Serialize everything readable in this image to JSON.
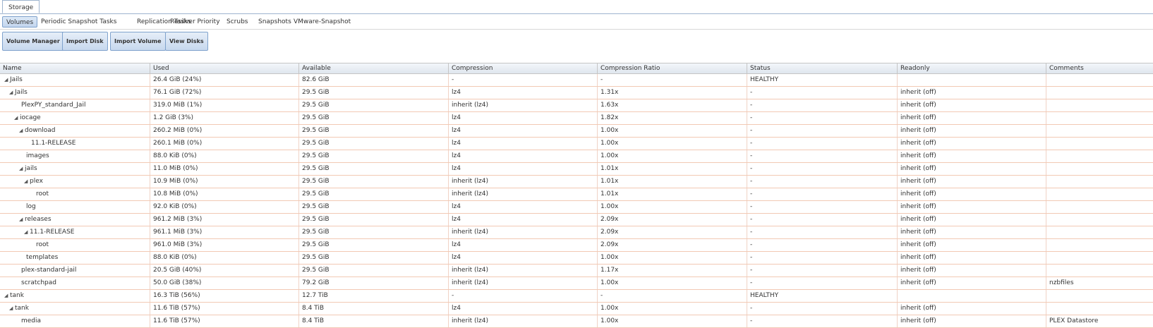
{
  "top_tab": "Storage",
  "subtabs": [
    "Volumes",
    "Periodic Snapshot Tasks",
    "Replication Tasks",
    "Resilver Priority",
    "Scrubs",
    "Snapshots",
    "VMware-Snapshot"
  ],
  "buttons": [
    "Volume Manager",
    "Import Disk",
    "Import Volume",
    "View Disks"
  ],
  "columns": [
    "Name",
    "Used",
    "Available",
    "Compression",
    "Compression Ratio",
    "Status",
    "Readonly",
    "Comments"
  ],
  "rows": [
    {
      "name": "Jails",
      "expanded": true,
      "used": "26.4 GiB (24%)",
      "available": "82.6 GiB",
      "compression": "-",
      "ratio": "-",
      "status": "HEALTHY",
      "readonly": "",
      "comments": ""
    },
    {
      "name": "Jails",
      "expanded": true,
      "used": "76.1 GiB (72%)",
      "available": "29.5 GiB",
      "compression": "lz4",
      "ratio": "1.31x",
      "status": "-",
      "readonly": "inherit (off)",
      "comments": ""
    },
    {
      "name": "PlexPY_standard_Jail",
      "expanded": false,
      "used": "319.0 MiB (1%)",
      "available": "29.5 GiB",
      "compression": "inherit (lz4)",
      "ratio": "1.63x",
      "status": "-",
      "readonly": "inherit (off)",
      "comments": ""
    },
    {
      "name": "iocage",
      "expanded": true,
      "used": "1.2 GiB (3%)",
      "available": "29.5 GiB",
      "compression": "lz4",
      "ratio": "1.82x",
      "status": "-",
      "readonly": "inherit (off)",
      "comments": ""
    },
    {
      "name": "download",
      "expanded": true,
      "used": "260.2 MiB (0%)",
      "available": "29.5 GiB",
      "compression": "lz4",
      "ratio": "1.00x",
      "status": "-",
      "readonly": "inherit (off)",
      "comments": ""
    },
    {
      "name": "11.1-RELEASE",
      "expanded": false,
      "used": "260.1 MiB (0%)",
      "available": "29.5 GiB",
      "compression": "lz4",
      "ratio": "1.00x",
      "status": "-",
      "readonly": "inherit (off)",
      "comments": ""
    },
    {
      "name": "images",
      "expanded": false,
      "used": "88.0 KiB (0%)",
      "available": "29.5 GiB",
      "compression": "lz4",
      "ratio": "1.00x",
      "status": "-",
      "readonly": "inherit (off)",
      "comments": ""
    },
    {
      "name": "jails",
      "expanded": true,
      "used": "11.0 MiB (0%)",
      "available": "29.5 GiB",
      "compression": "lz4",
      "ratio": "1.01x",
      "status": "-",
      "readonly": "inherit (off)",
      "comments": ""
    },
    {
      "name": "plex",
      "expanded": true,
      "used": "10.9 MiB (0%)",
      "available": "29.5 GiB",
      "compression": "inherit (lz4)",
      "ratio": "1.01x",
      "status": "-",
      "readonly": "inherit (off)",
      "comments": ""
    },
    {
      "name": "root",
      "expanded": false,
      "used": "10.8 MiB (0%)",
      "available": "29.5 GiB",
      "compression": "inherit (lz4)",
      "ratio": "1.01x",
      "status": "-",
      "readonly": "inherit (off)",
      "comments": ""
    },
    {
      "name": "log",
      "expanded": false,
      "used": "92.0 KiB (0%)",
      "available": "29.5 GiB",
      "compression": "lz4",
      "ratio": "1.00x",
      "status": "-",
      "readonly": "inherit (off)",
      "comments": ""
    },
    {
      "name": "releases",
      "expanded": true,
      "used": "961.2 MiB (3%)",
      "available": "29.5 GiB",
      "compression": "lz4",
      "ratio": "2.09x",
      "status": "-",
      "readonly": "inherit (off)",
      "comments": ""
    },
    {
      "name": "11.1-RELEASE",
      "expanded": true,
      "used": "961.1 MiB (3%)",
      "available": "29.5 GiB",
      "compression": "inherit (lz4)",
      "ratio": "2.09x",
      "status": "-",
      "readonly": "inherit (off)",
      "comments": ""
    },
    {
      "name": "root",
      "expanded": false,
      "used": "961.0 MiB (3%)",
      "available": "29.5 GiB",
      "compression": "lz4",
      "ratio": "2.09x",
      "status": "-",
      "readonly": "inherit (off)",
      "comments": ""
    },
    {
      "name": "templates",
      "expanded": false,
      "used": "88.0 KiB (0%)",
      "available": "29.5 GiB",
      "compression": "lz4",
      "ratio": "1.00x",
      "status": "-",
      "readonly": "inherit (off)",
      "comments": ""
    },
    {
      "name": "plex-standard-jail",
      "expanded": false,
      "used": "20.5 GiB (40%)",
      "available": "29.5 GiB",
      "compression": "inherit (lz4)",
      "ratio": "1.17x",
      "status": "-",
      "readonly": "inherit (off)",
      "comments": ""
    },
    {
      "name": "scratchpad",
      "expanded": false,
      "used": "50.0 GiB (38%)",
      "available": "79.2 GiB",
      "compression": "inherit (lz4)",
      "ratio": "1.00x",
      "status": "-",
      "readonly": "inherit (off)",
      "comments": "nzbfiles"
    },
    {
      "name": "tank",
      "expanded": true,
      "used": "16.3 TiB (56%)",
      "available": "12.7 TiB",
      "compression": "-",
      "ratio": "-",
      "status": "HEALTHY",
      "readonly": "",
      "comments": ""
    },
    {
      "name": "tank",
      "expanded": true,
      "used": "11.6 TiB (57%)",
      "available": "8.4 TiB",
      "compression": "lz4",
      "ratio": "1.00x",
      "status": "-",
      "readonly": "inherit (off)",
      "comments": ""
    },
    {
      "name": "media",
      "expanded": false,
      "used": "11.6 TiB (57%)",
      "available": "8.4 TiB",
      "compression": "inherit (lz4)",
      "ratio": "1.00x",
      "status": "-",
      "readonly": "inherit (off)",
      "comments": "PLEX Datastore"
    }
  ]
}
